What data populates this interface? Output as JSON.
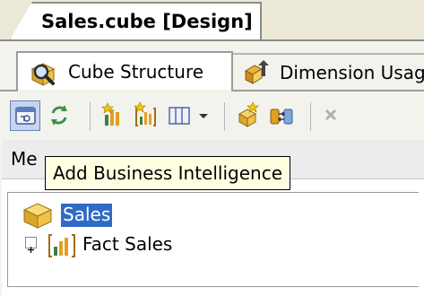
{
  "document_tab": {
    "title": "Sales.cube [Design]"
  },
  "designer_tabs": [
    {
      "label": "Cube Structure",
      "icon": "cube-structure-magnifier-icon",
      "selected": true
    },
    {
      "label": "Dimension Usag",
      "icon": "dimension-usage-icon",
      "selected": false
    }
  ],
  "toolbar": {
    "buttons": [
      {
        "icon": "add-business-intelligence-icon",
        "pressed": true
      },
      {
        "icon": "refresh-icon"
      },
      {
        "icon": "new-measure-icon"
      },
      {
        "icon": "new-measure-group-icon"
      },
      {
        "icon": "show-measure-grid-icon"
      },
      {
        "icon": "dropdown-arrow-icon"
      },
      {
        "icon": "add-cube-dimension-icon"
      },
      {
        "icon": "new-linked-object-icon"
      },
      {
        "icon": "delete-icon",
        "disabled": true
      }
    ]
  },
  "pane": {
    "header_visible_text": "Me"
  },
  "tooltip": {
    "text": "Add Business Intelligence"
  },
  "tree": {
    "root": {
      "label": "Sales",
      "icon": "cube-icon",
      "selected": true
    },
    "children": [
      {
        "label": "Fact Sales",
        "icon": "measure-group-icon",
        "expander": "+"
      }
    ]
  },
  "colors": {
    "chrome": "#ece9d8",
    "selection": "#316ac5",
    "tooltip_bg": "#ffffe1"
  }
}
